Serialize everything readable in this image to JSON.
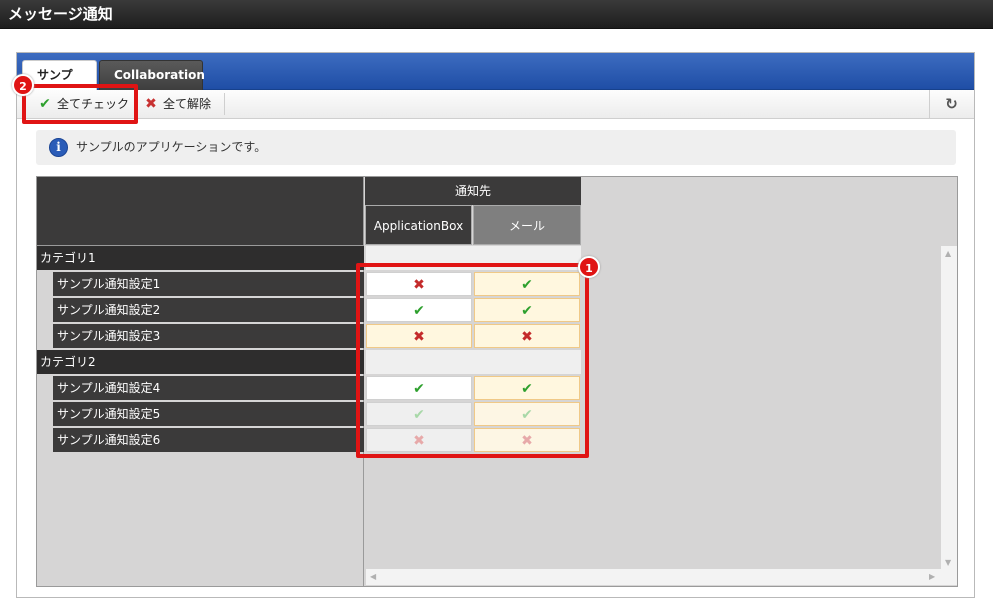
{
  "app": {
    "title": "メッセージ通知"
  },
  "tabs": [
    {
      "label": "サンプル",
      "active": true
    },
    {
      "label": "Collaboration",
      "active": false
    }
  ],
  "toolbar": {
    "check_all": "全てチェック",
    "uncheck_all": "全て解除",
    "refresh_icon": "refresh-icon"
  },
  "info": {
    "message": "サンプルのアプリケーションです。"
  },
  "grid": {
    "group_header": "通知先",
    "columns": [
      "ApplicationBox",
      "メール"
    ],
    "categories": [
      {
        "name": "カテゴリ1",
        "items": [
          {
            "label": "サンプル通知設定1",
            "app": "x",
            "mail": "check",
            "enabled": true
          },
          {
            "label": "サンプル通知設定2",
            "app": "check",
            "mail": "check",
            "enabled": true
          },
          {
            "label": "サンプル通知設定3",
            "app": "x",
            "mail": "x",
            "enabled": true
          }
        ]
      },
      {
        "name": "カテゴリ2",
        "items": [
          {
            "label": "サンプル通知設定4",
            "app": "check",
            "mail": "check",
            "enabled": true
          },
          {
            "label": "サンプル通知設定5",
            "app": "check",
            "mail": "check",
            "enabled": false
          },
          {
            "label": "サンプル通知設定6",
            "app": "x",
            "mail": "x",
            "enabled": false
          }
        ]
      }
    ]
  },
  "annotations": {
    "badge1": "1",
    "badge2": "2"
  },
  "colors": {
    "highlight": "#e01414",
    "tab_bar": "#1f4ea6",
    "check": "#2ea02e",
    "cross": "#c42b2b"
  }
}
